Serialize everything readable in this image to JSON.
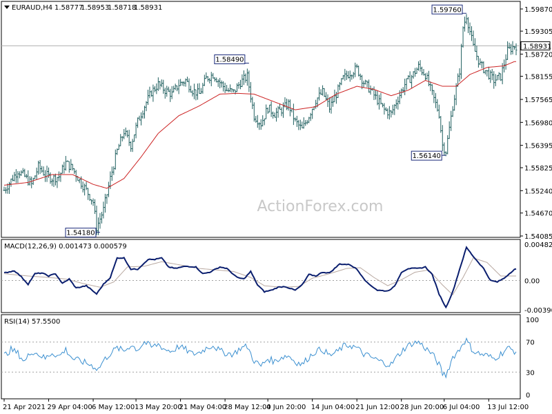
{
  "chart_data": {
    "type": "ohlc",
    "symbol_header": {
      "title": "EURAUD,H4",
      "open": "1.58777",
      "high": "1.58953",
      "low": "1.58718",
      "close": "1.58931"
    },
    "watermark": "ActionForex.com",
    "colors": {
      "price_bars": "#1e5e5e",
      "moving_average": "#cc2222",
      "macd_line": "#0a1e6e",
      "macd_signal": "#b8a8a0",
      "rsi_line": "#3a8fd0",
      "current_price_line": "#b0b0b0",
      "grid_dotted": "#a0a0a0",
      "background": "#ffffff"
    },
    "x_axis_labels": [
      "21 Apr 2021",
      "29 Apr 04:00",
      "6 May 12:00",
      "13 May 20:00",
      "21 May 04:00",
      "28 May 12:00",
      "4 Jun 20:00",
      "14 Jun 04:00",
      "21 Jun 12:00",
      "28 Jun 20:00",
      "6 Jul 04:00",
      "13 Jul 12:00"
    ],
    "price_panel": {
      "y_ticks": [
        "1.59870",
        "1.59305",
        "1.58720",
        "1.58155",
        "1.57565",
        "1.56980",
        "1.56395",
        "1.55825",
        "1.55240",
        "1.54670",
        "1.54085"
      ],
      "ylim": [
        1.54085,
        1.5987
      ],
      "current_price": "1.58931",
      "annotations": [
        {
          "label": "1.54180",
          "x_label": "6 May 12:00",
          "value": 1.5418
        },
        {
          "label": "1.58490",
          "x_label": "28 May 12:00",
          "value": 1.5849
        },
        {
          "label": "1.56140",
          "x_label": "6 Jul 04:00",
          "value": 1.5614
        },
        {
          "label": "1.59760",
          "x_label": "6 Jul 04:00",
          "value": 1.5976
        }
      ],
      "close_series_keypoints": [
        [
          0,
          1.5525
        ],
        [
          4,
          1.555
        ],
        [
          8,
          1.5575
        ],
        [
          12,
          1.556
        ],
        [
          16,
          1.554
        ],
        [
          20,
          1.5585
        ],
        [
          24,
          1.5565
        ],
        [
          28,
          1.5555
        ],
        [
          32,
          1.556
        ],
        [
          36,
          1.5595
        ],
        [
          40,
          1.558
        ],
        [
          44,
          1.555
        ],
        [
          48,
          1.5525
        ],
        [
          52,
          1.5495
        ],
        [
          54,
          1.543
        ],
        [
          58,
          1.5475
        ],
        [
          62,
          1.5555
        ],
        [
          66,
          1.5625
        ],
        [
          70,
          1.5675
        ],
        [
          74,
          1.564
        ],
        [
          78,
          1.57
        ],
        [
          82,
          1.574
        ],
        [
          86,
          1.5775
        ],
        [
          90,
          1.5795
        ],
        [
          94,
          1.578
        ],
        [
          98,
          1.577
        ],
        [
          102,
          1.5795
        ],
        [
          106,
          1.5805
        ],
        [
          110,
          1.578
        ],
        [
          114,
          1.577
        ],
        [
          118,
          1.581
        ],
        [
          122,
          1.582
        ],
        [
          126,
          1.58
        ],
        [
          130,
          1.578
        ],
        [
          134,
          1.5775
        ],
        [
          138,
          1.58
        ],
        [
          142,
          1.5815
        ],
        [
          146,
          1.5715
        ],
        [
          150,
          1.5695
        ],
        [
          154,
          1.5735
        ],
        [
          158,
          1.572
        ],
        [
          162,
          1.573
        ],
        [
          166,
          1.5745
        ],
        [
          170,
          1.57
        ],
        [
          174,
          1.568
        ],
        [
          178,
          1.5715
        ],
        [
          182,
          1.5755
        ],
        [
          186,
          1.5775
        ],
        [
          190,
          1.5735
        ],
        [
          194,
          1.577
        ],
        [
          198,
          1.581
        ],
        [
          202,
          1.5825
        ],
        [
          206,
          1.5835
        ],
        [
          210,
          1.58
        ],
        [
          214,
          1.578
        ],
        [
          218,
          1.5755
        ],
        [
          222,
          1.573
        ],
        [
          226,
          1.572
        ],
        [
          230,
          1.576
        ],
        [
          234,
          1.5795
        ],
        [
          238,
          1.5815
        ],
        [
          242,
          1.584
        ],
        [
          246,
          1.582
        ],
        [
          250,
          1.577
        ],
        [
          254,
          1.572
        ],
        [
          256,
          1.564
        ],
        [
          258,
          1.5625
        ],
        [
          262,
          1.574
        ],
        [
          266,
          1.583
        ],
        [
          268,
          1.594
        ],
        [
          270,
          1.597
        ],
        [
          274,
          1.589
        ],
        [
          278,
          1.5845
        ],
        [
          282,
          1.5825
        ],
        [
          286,
          1.5805
        ],
        [
          290,
          1.5815
        ],
        [
          294,
          1.588
        ],
        [
          298,
          1.5893
        ]
      ],
      "ma_series_keypoints": [
        [
          0,
          1.5538
        ],
        [
          14,
          1.5545
        ],
        [
          28,
          1.5565
        ],
        [
          40,
          1.5565
        ],
        [
          52,
          1.554
        ],
        [
          60,
          1.553
        ],
        [
          70,
          1.5555
        ],
        [
          80,
          1.561
        ],
        [
          90,
          1.567
        ],
        [
          102,
          1.5715
        ],
        [
          114,
          1.574
        ],
        [
          126,
          1.577
        ],
        [
          136,
          1.5772
        ],
        [
          146,
          1.577
        ],
        [
          158,
          1.575
        ],
        [
          170,
          1.573
        ],
        [
          182,
          1.5738
        ],
        [
          194,
          1.577
        ],
        [
          206,
          1.579
        ],
        [
          216,
          1.5782
        ],
        [
          226,
          1.5766
        ],
        [
          236,
          1.578
        ],
        [
          246,
          1.5805
        ],
        [
          256,
          1.579
        ],
        [
          264,
          1.579
        ],
        [
          272,
          1.582
        ],
        [
          282,
          1.5838
        ],
        [
          292,
          1.5842
        ],
        [
          298,
          1.5853
        ]
      ]
    },
    "macd_panel": {
      "label": "MACD(12,26,9) 0.001473 0.000579",
      "y_ticks": [
        "0.004821",
        "0.00",
        "-0.003905"
      ],
      "ylim": [
        -0.003905,
        0.004821
      ],
      "macd_keypoints": [
        [
          0,
          0.001
        ],
        [
          6,
          0.0013
        ],
        [
          10,
          0.0005
        ],
        [
          14,
          -0.0005
        ],
        [
          18,
          0.0009
        ],
        [
          22,
          0.001
        ],
        [
          26,
          0.0006
        ],
        [
          30,
          0.0009
        ],
        [
          34,
          -0.0004
        ],
        [
          38,
          0.0002
        ],
        [
          42,
          -0.001
        ],
        [
          48,
          -0.0007
        ],
        [
          54,
          -0.0018
        ],
        [
          58,
          -0.0005
        ],
        [
          62,
          0.0004
        ],
        [
          66,
          0.003
        ],
        [
          70,
          0.003
        ],
        [
          74,
          0.0015
        ],
        [
          78,
          0.0015
        ],
        [
          84,
          0.0028
        ],
        [
          88,
          0.0028
        ],
        [
          92,
          0.003
        ],
        [
          96,
          0.0018
        ],
        [
          100,
          0.0016
        ],
        [
          106,
          0.0019
        ],
        [
          112,
          0.0018
        ],
        [
          116,
          0.0009
        ],
        [
          120,
          0.0011
        ],
        [
          126,
          0.0018
        ],
        [
          130,
          0.0016
        ],
        [
          136,
          0.0004
        ],
        [
          140,
          0.0002
        ],
        [
          144,
          0.0012
        ],
        [
          148,
          -0.0006
        ],
        [
          152,
          -0.0015
        ],
        [
          156,
          -0.0013
        ],
        [
          160,
          -0.0009
        ],
        [
          164,
          -0.0008
        ],
        [
          170,
          -0.0013
        ],
        [
          174,
          -0.0006
        ],
        [
          178,
          0.0008
        ],
        [
          182,
          0.0006
        ],
        [
          186,
          0.0011
        ],
        [
          190,
          0.001
        ],
        [
          196,
          0.0022
        ],
        [
          202,
          0.0021
        ],
        [
          206,
          0.0015
        ],
        [
          212,
          -0.0003
        ],
        [
          218,
          -0.0013
        ],
        [
          224,
          -0.0014
        ],
        [
          228,
          -0.0008
        ],
        [
          232,
          0.0011
        ],
        [
          236,
          0.0016
        ],
        [
          242,
          0.0016
        ],
        [
          246,
          0.0018
        ],
        [
          250,
          0.0008
        ],
        [
          254,
          -0.0018
        ],
        [
          258,
          -0.0036
        ],
        [
          262,
          -0.0015
        ],
        [
          266,
          0.0015
        ],
        [
          270,
          0.0044
        ],
        [
          274,
          0.0032
        ],
        [
          280,
          0.0016
        ],
        [
          284,
          0.0
        ],
        [
          288,
          -0.0002
        ],
        [
          292,
          0.0003
        ],
        [
          298,
          0.0015
        ]
      ],
      "signal_keypoints": [
        [
          0,
          0.0009
        ],
        [
          14,
          0.0006
        ],
        [
          26,
          0.0004
        ],
        [
          36,
          0.0002
        ],
        [
          46,
          -0.0004
        ],
        [
          56,
          -0.0009
        ],
        [
          64,
          -0.0002
        ],
        [
          72,
          0.0018
        ],
        [
          82,
          0.0019
        ],
        [
          92,
          0.0025
        ],
        [
          102,
          0.0021
        ],
        [
          114,
          0.0016
        ],
        [
          124,
          0.0014
        ],
        [
          134,
          0.0012
        ],
        [
          144,
          0.0004
        ],
        [
          152,
          -0.0007
        ],
        [
          162,
          -0.0009
        ],
        [
          172,
          -0.0008
        ],
        [
          180,
          0.0003
        ],
        [
          190,
          0.0009
        ],
        [
          200,
          0.0016
        ],
        [
          208,
          0.0017
        ],
        [
          216,
          0.0004
        ],
        [
          224,
          -0.0007
        ],
        [
          232,
          0.0001
        ],
        [
          240,
          0.0011
        ],
        [
          248,
          0.0014
        ],
        [
          256,
          -0.0006
        ],
        [
          262,
          -0.0019
        ],
        [
          268,
          0.0004
        ],
        [
          274,
          0.003
        ],
        [
          282,
          0.0024
        ],
        [
          290,
          0.0006
        ],
        [
          298,
          0.0006
        ]
      ]
    },
    "rsi_panel": {
      "label": "RSI(14) 57.5500",
      "y_ticks": [
        "100",
        "70",
        "30",
        "0"
      ],
      "ylim": [
        0,
        100
      ],
      "levels": [
        70,
        30
      ],
      "rsi_keypoints": [
        [
          0,
          52
        ],
        [
          4,
          60
        ],
        [
          8,
          55
        ],
        [
          12,
          44
        ],
        [
          16,
          58
        ],
        [
          20,
          54
        ],
        [
          24,
          48
        ],
        [
          28,
          56
        ],
        [
          32,
          51
        ],
        [
          36,
          60
        ],
        [
          40,
          48
        ],
        [
          44,
          45
        ],
        [
          48,
          42
        ],
        [
          52,
          38
        ],
        [
          55,
          34
        ],
        [
          58,
          45
        ],
        [
          62,
          55
        ],
        [
          66,
          62
        ],
        [
          70,
          58
        ],
        [
          74,
          66
        ],
        [
          78,
          60
        ],
        [
          82,
          70
        ],
        [
          86,
          63
        ],
        [
          90,
          67
        ],
        [
          94,
          60
        ],
        [
          98,
          58
        ],
        [
          102,
          64
        ],
        [
          106,
          60
        ],
        [
          110,
          54
        ],
        [
          114,
          56
        ],
        [
          118,
          62
        ],
        [
          122,
          66
        ],
        [
          126,
          58
        ],
        [
          130,
          55
        ],
        [
          134,
          54
        ],
        [
          138,
          62
        ],
        [
          142,
          64
        ],
        [
          146,
          45
        ],
        [
          150,
          38
        ],
        [
          154,
          48
        ],
        [
          158,
          44
        ],
        [
          162,
          50
        ],
        [
          166,
          52
        ],
        [
          170,
          44
        ],
        [
          174,
          40
        ],
        [
          178,
          50
        ],
        [
          182,
          58
        ],
        [
          186,
          60
        ],
        [
          190,
          52
        ],
        [
          194,
          56
        ],
        [
          198,
          64
        ],
        [
          202,
          66
        ],
        [
          206,
          62
        ],
        [
          210,
          54
        ],
        [
          214,
          50
        ],
        [
          218,
          46
        ],
        [
          222,
          42
        ],
        [
          226,
          40
        ],
        [
          230,
          52
        ],
        [
          234,
          62
        ],
        [
          238,
          68
        ],
        [
          242,
          70
        ],
        [
          246,
          62
        ],
        [
          250,
          54
        ],
        [
          254,
          40
        ],
        [
          256,
          28
        ],
        [
          258,
          26
        ],
        [
          262,
          50
        ],
        [
          266,
          60
        ],
        [
          268,
          70
        ],
        [
          270,
          72
        ],
        [
          274,
          58
        ],
        [
          278,
          54
        ],
        [
          282,
          52
        ],
        [
          286,
          48
        ],
        [
          290,
          54
        ],
        [
          294,
          62
        ],
        [
          298,
          58
        ]
      ]
    }
  }
}
